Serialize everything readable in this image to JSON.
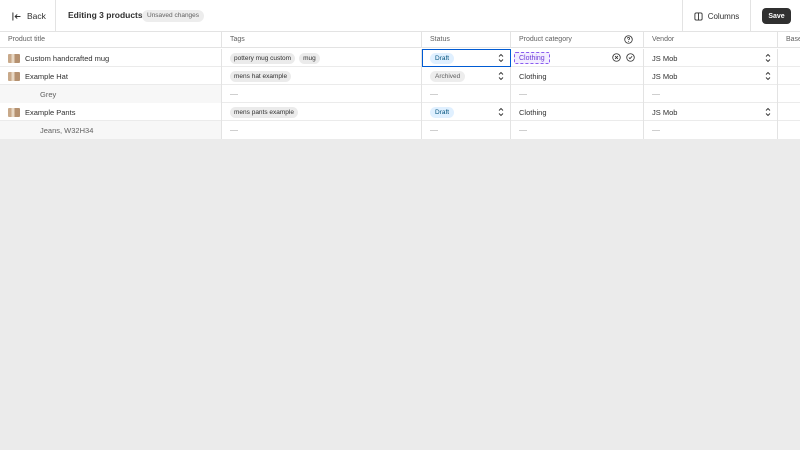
{
  "topbar": {
    "back_label": "Back",
    "title": "Editing 3 products",
    "unsaved_badge": "Unsaved changes",
    "columns_label": "Columns",
    "save_label": "Save"
  },
  "columns": [
    "Product title",
    "Tags",
    "Status",
    "Product category",
    "Vendor",
    "Base"
  ],
  "rows": [
    {
      "title": "Custom handcrafted mug",
      "tags": [
        "pottery mug custom",
        "mug"
      ],
      "status": "Draft",
      "category": "Clothing",
      "vendor": "JS Mob"
    },
    {
      "title": "Example Hat",
      "tags": [
        "mens hat example"
      ],
      "status": "Archived",
      "category": "Clothing",
      "vendor": "JS Mob"
    },
    {
      "variant": "Grey"
    },
    {
      "title": "Example Pants",
      "tags": [
        "mens pants example"
      ],
      "status": "Draft",
      "category": "Clothing",
      "vendor": "JS Mob"
    },
    {
      "variant": "Jeans, W32H34"
    }
  ],
  "icons": {
    "back": "arrow-left-icon",
    "columns": "columns-icon",
    "help": "question-circle-icon",
    "clear": "x-circle-icon",
    "confirm": "check-circle-icon",
    "select": "chevron-up-down-icon"
  },
  "colors": {
    "accent": "#005bd3",
    "draft_bg": "#e0f0ff",
    "category_edit": "#8a5cf0",
    "save_bg": "#303030"
  }
}
